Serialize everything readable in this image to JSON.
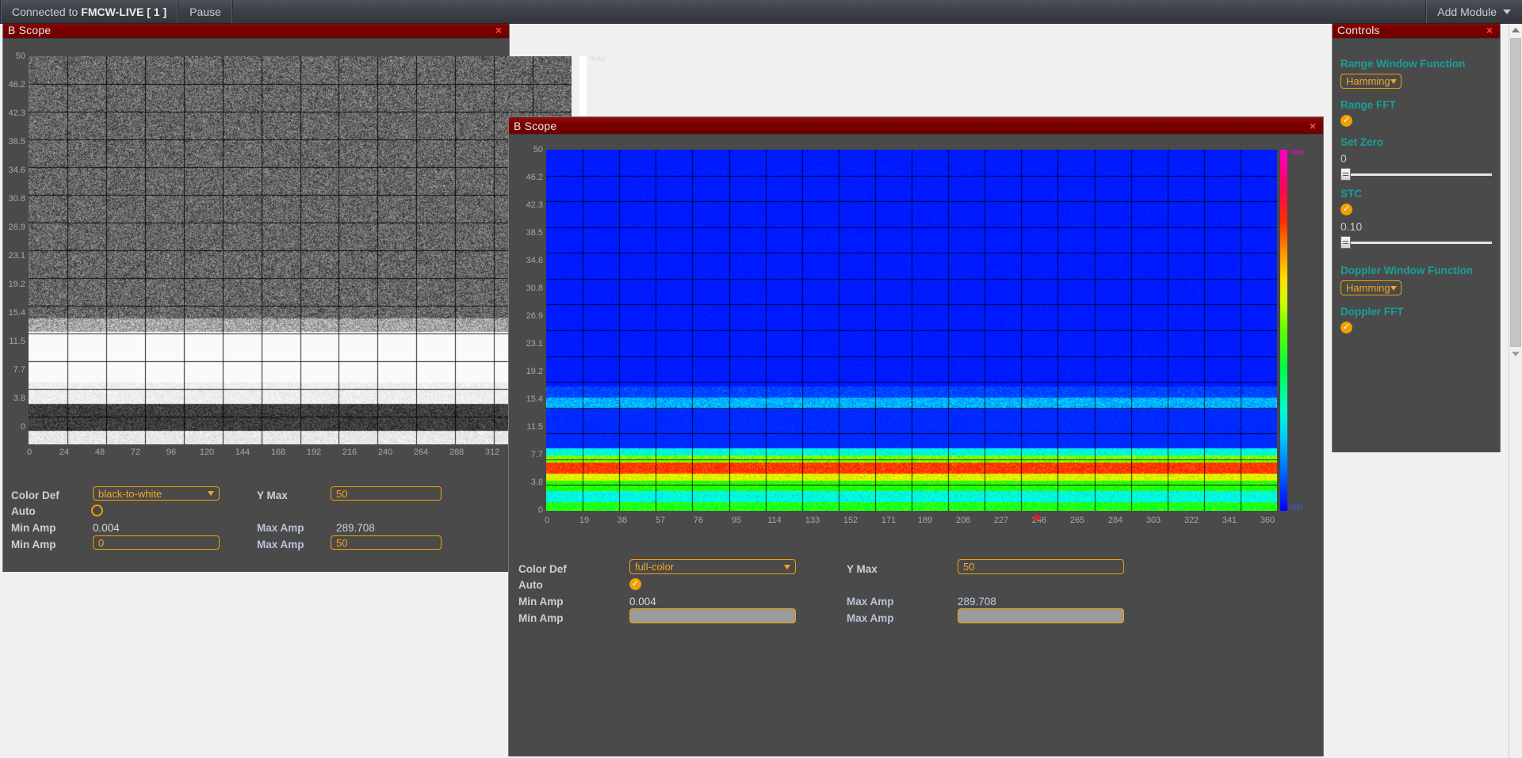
{
  "topbar": {
    "connection_prefix": "Connected to ",
    "connection_name": "FMCW-LIVE [ 1 ]",
    "pause_label": "Pause",
    "add_module_label": "Add Module"
  },
  "windows": [
    {
      "title": "B Scope",
      "close_label": "×",
      "colorbar": {
        "scheme": "black-to-white",
        "max_label": "max",
        "min_label": "",
        "max_color": "#ffffff",
        "min_color": "#000000"
      },
      "plot": {
        "y_ticks": [
          "50",
          "46.2",
          "42.3",
          "38.5",
          "34.6",
          "30.8",
          "26.9",
          "23.1",
          "19.2",
          "15.4",
          "11.5",
          "7.7",
          "3.8",
          "0"
        ],
        "x_ticks": [
          "0",
          "24",
          "48",
          "72",
          "96",
          "120",
          "144",
          "168",
          "192",
          "216",
          "240",
          "264",
          "288",
          "312"
        ]
      },
      "controls": {
        "color_def_label": "Color Def",
        "color_def_value": "black-to-white",
        "y_max_label": "Y Max",
        "y_max_value": "50",
        "auto_label": "Auto",
        "auto_checked": false,
        "min_amp_label": "Min Amp",
        "min_amp_readout": "0.004",
        "max_amp_label": "Max Amp",
        "max_amp_readout": "289.708",
        "min_amp_input": "0",
        "max_amp_input": "50"
      }
    },
    {
      "title": "B Scope",
      "close_label": "×",
      "colorbar": {
        "scheme": "full-color",
        "max_label": "max",
        "min_label": "min",
        "max_color": "#ff00c8",
        "min_color": "#0000ff"
      },
      "plot": {
        "y_ticks": [
          "50",
          "46.2",
          "42.3",
          "38.5",
          "34.6",
          "30.8",
          "26.9",
          "23.1",
          "19.2",
          "15.4",
          "11.5",
          "7.7",
          "3.8",
          "0"
        ],
        "x_ticks": [
          "0",
          "19",
          "38",
          "57",
          "76",
          "95",
          "114",
          "133",
          "152",
          "171",
          "189",
          "208",
          "227",
          "246",
          "265",
          "284",
          "303",
          "322",
          "341",
          "360"
        ],
        "marker_position": "338"
      },
      "controls": {
        "color_def_label": "Color Def",
        "color_def_value": "full-color",
        "y_max_label": "Y Max",
        "y_max_value": "50",
        "auto_label": "Auto",
        "auto_checked": true,
        "min_amp_label": "Min Amp",
        "min_amp_readout": "0.004",
        "max_amp_label": "Max Amp",
        "max_amp_readout": "289.708",
        "min_amp_input": "",
        "max_amp_input": ""
      }
    }
  ],
  "controls_panel": {
    "title": "Controls",
    "close_label": "×",
    "sections": [
      {
        "heading": "Range Window Function",
        "type": "select",
        "value": "Hamming"
      },
      {
        "heading": "Range FFT",
        "type": "checkbox",
        "checked": true
      },
      {
        "heading": "Set Zero",
        "type": "slider",
        "value": "0",
        "thumb_pct": 0
      },
      {
        "heading": "STC",
        "type": "checkbox-slider",
        "checked": true,
        "value": "0.10",
        "thumb_pct": 0
      },
      {
        "heading": "Doppler Window Function",
        "type": "select",
        "value": "Hamming"
      },
      {
        "heading": "Doppler FFT",
        "type": "checkbox",
        "checked": true
      }
    ]
  },
  "colors": {
    "accent_orange": "#f0a000",
    "title_red": "#7a0000",
    "teal_heading": "#18a09a",
    "panel_bg": "#4a4a4a"
  }
}
